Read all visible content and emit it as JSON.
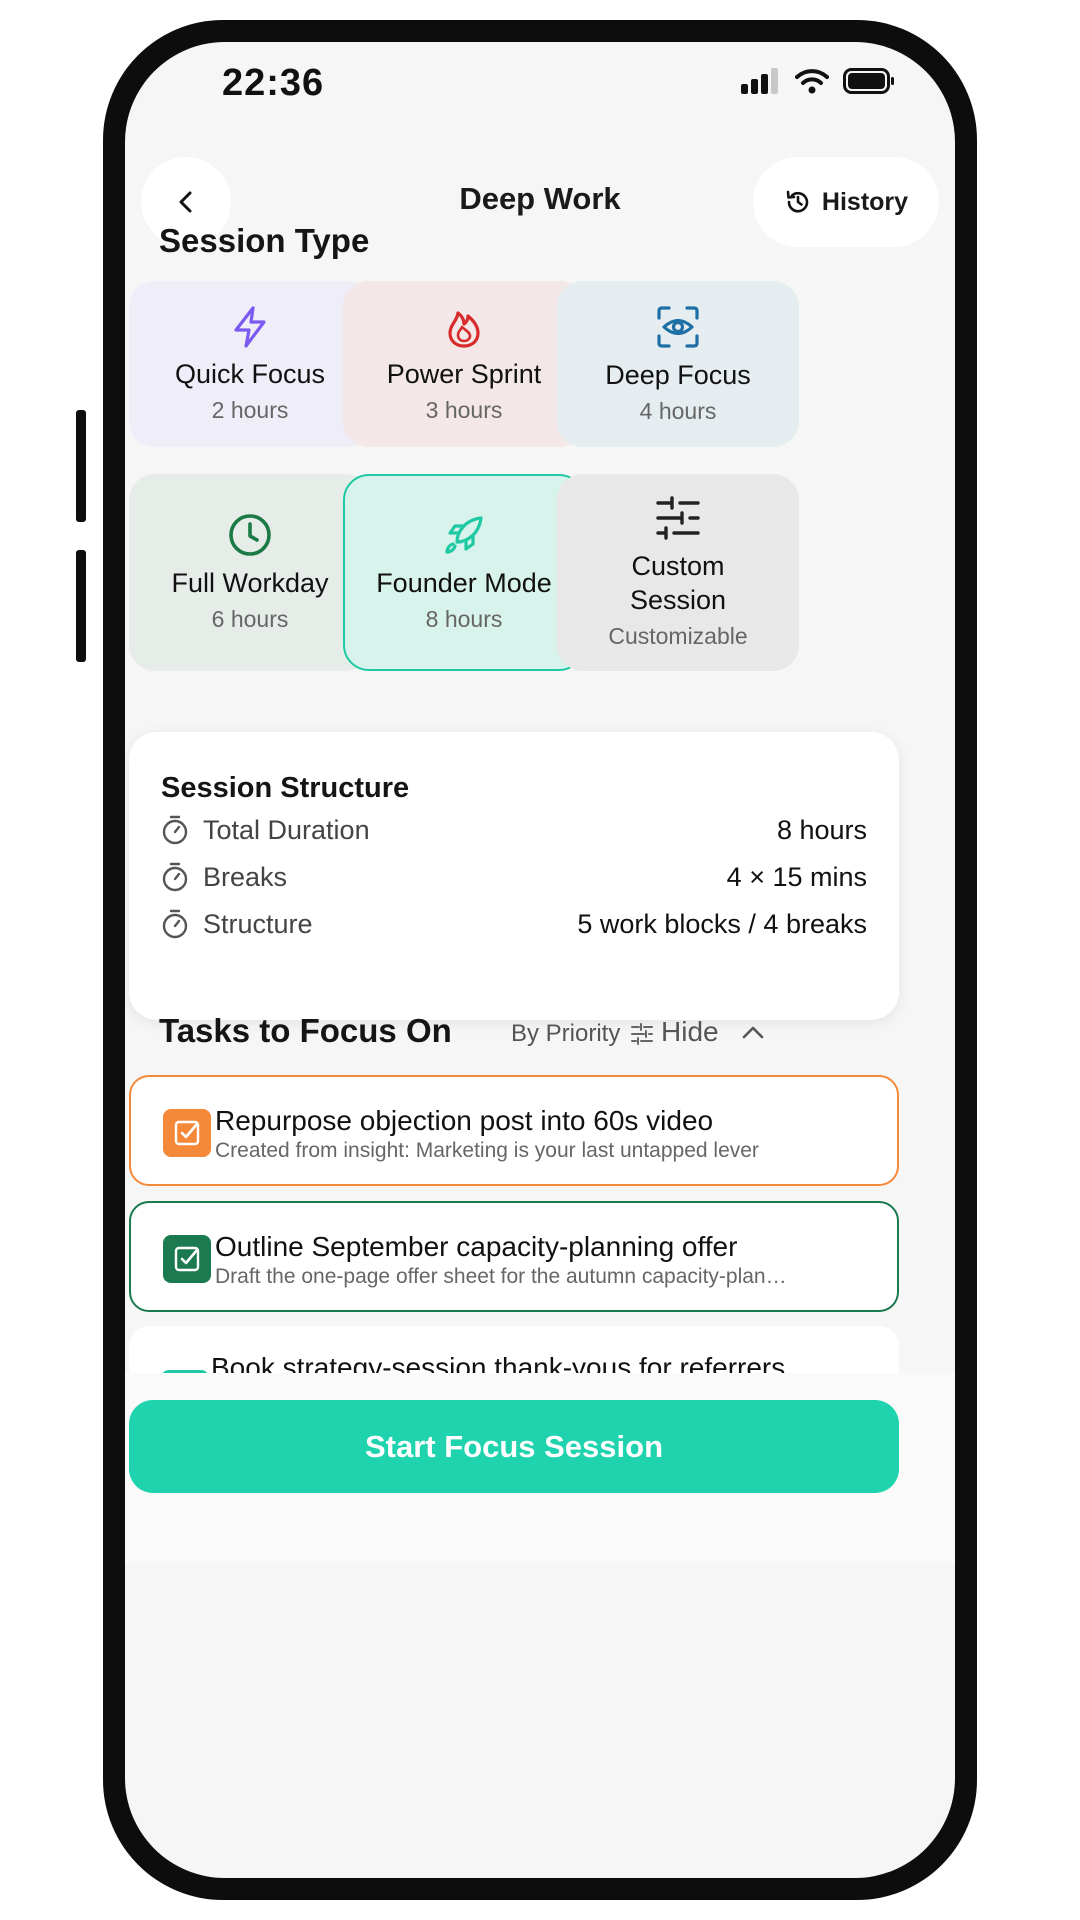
{
  "status": {
    "time": "22:36"
  },
  "header": {
    "title": "Deep Work",
    "history_label": "History"
  },
  "session_type": {
    "heading": "Session Type",
    "options": [
      {
        "name": "Quick Focus",
        "duration": "2 hours",
        "icon": "lightning-icon",
        "bg": "#efedf8",
        "color": "#7a5af0"
      },
      {
        "name": "Power Sprint",
        "duration": "3 hours",
        "icon": "flame-icon",
        "bg": "#f4e7e7",
        "color": "#d82b2b"
      },
      {
        "name": "Deep Focus",
        "duration": "4 hours",
        "icon": "eye-scan-icon",
        "bg": "#e6edf0",
        "color": "#1d6fa5"
      },
      {
        "name": "Full Workday",
        "duration": "6 hours",
        "icon": "clock-icon",
        "bg": "#e6ede8",
        "color": "#1b7a45"
      },
      {
        "name": "Founder Mode",
        "duration": "8 hours",
        "icon": "rocket-icon",
        "bg": "#d8f3ec",
        "color": "#1ec9a3",
        "selected": true
      },
      {
        "name": "Custom Session",
        "duration": "Customizable",
        "icon": "sliders-icon",
        "bg": "#e8e8e8",
        "color": "#222222"
      }
    ]
  },
  "structure": {
    "title": "Session Structure",
    "rows": [
      {
        "label": "Total Duration",
        "value": "8 hours"
      },
      {
        "label": "Breaks",
        "value": "4 × 15 mins"
      },
      {
        "label": "Structure",
        "value": "5 work blocks / 4 breaks"
      }
    ]
  },
  "tasks": {
    "heading": "Tasks to Focus On",
    "sort_label": "By Priority",
    "hide_label": "Hide",
    "items": [
      {
        "title": "Repurpose objection post into 60s video",
        "subtitle": "Created from insight: Marketing is your last untapped lever",
        "accent": "#f5893a"
      },
      {
        "title": "Outline September capacity-planning offer",
        "subtitle": "Draft the one-page offer sheet for the autumn capacity-plan…",
        "accent": "#1b7a4f"
      },
      {
        "title": "Book strategy-session thank-yous for referrers",
        "subtitle": "",
        "accent": "#1ec9a3"
      }
    ]
  },
  "cta": {
    "label": "Start Focus Session"
  }
}
